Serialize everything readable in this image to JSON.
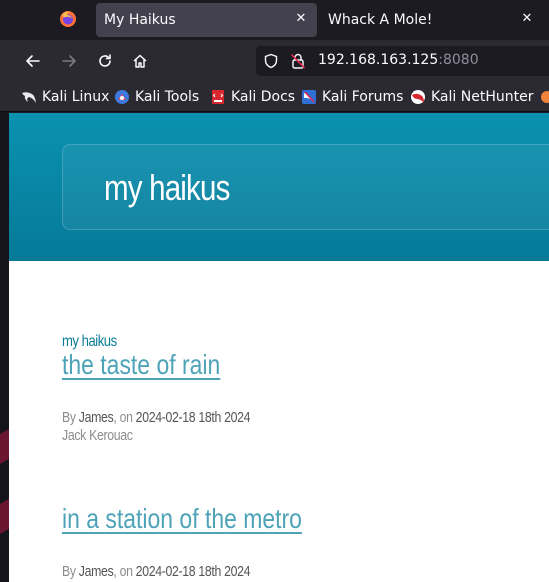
{
  "browser": {
    "tabs": [
      {
        "title": "My Haikus",
        "active": true
      },
      {
        "title": "Whack A Mole!",
        "active": false
      }
    ],
    "close_glyph": "✕",
    "url_host": "192.168.163.125",
    "url_port": ":8080",
    "bookmarks": [
      {
        "label": "Kali Linux",
        "icon": "kali-dragon-icon"
      },
      {
        "label": "Kali Tools",
        "icon": "kali-tools-icon"
      },
      {
        "label": "Kali Docs",
        "icon": "kali-docs-icon"
      },
      {
        "label": "Kali Forums",
        "icon": "kali-forums-icon"
      },
      {
        "label": "Kali NetHunter",
        "icon": "kali-nethunter-icon"
      }
    ]
  },
  "page": {
    "site_title": "my haikus",
    "category": "my haikus",
    "posts": [
      {
        "title": "the taste of rain",
        "by": "By ",
        "author": "James",
        "on": ", on ",
        "date": "2024-02-18 18th 2024",
        "poet": "Jack Kerouac"
      },
      {
        "title": "in a station of the metro",
        "by": "By ",
        "author": "James",
        "on": ", on ",
        "date": "2024-02-18 18th 2024"
      }
    ]
  },
  "colors": {
    "header": "#0b91b1",
    "link": "#4da3b7",
    "category": "#0a7d96"
  }
}
